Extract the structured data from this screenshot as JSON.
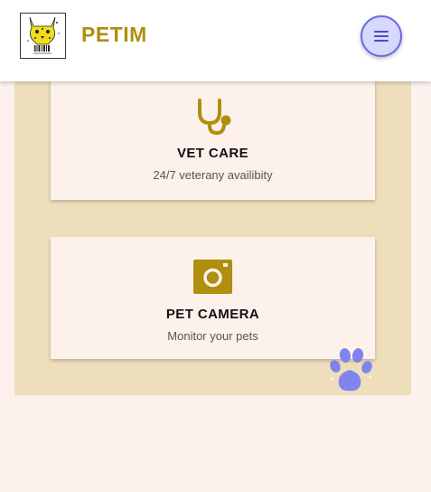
{
  "header": {
    "brand": "PETIM",
    "logo_icon": "cheetah-logo-icon",
    "menu_icon": "hamburger-menu-icon"
  },
  "services": [
    {
      "icon": "stethoscope-icon",
      "title": "VET CARE",
      "description": "24/7 veterany availibity"
    },
    {
      "icon": "camera-icon",
      "title": "PET CAMERA",
      "description": "Monitor your pets"
    }
  ],
  "decor": {
    "paw_icon": "paw-print-icon"
  },
  "colors": {
    "brand": "#b08e0e",
    "accent": "#6b6be8",
    "section_bg": "#eedebb",
    "card_bg": "#fdf1ec",
    "page_bg": "#fcf1ec"
  }
}
